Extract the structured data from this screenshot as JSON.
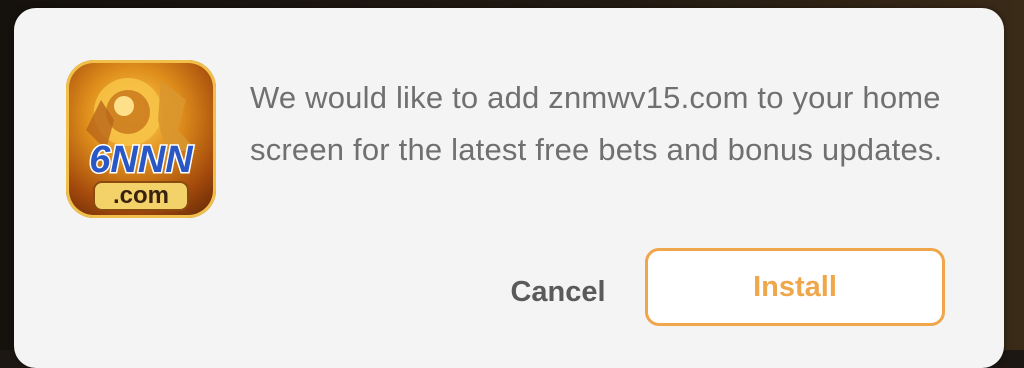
{
  "dialog": {
    "message": "We would like to add znmwv15.com to your home screen for the latest free bets and bonus updates.",
    "app_icon": {
      "icon": "app-logo-icon",
      "brand_text": "6NNN",
      "domain_text": ".com"
    },
    "cancel_label": "Cancel",
    "install_label": "Install"
  },
  "colors": {
    "dialog_background": "#f4f4f4",
    "message_text": "#707070",
    "cancel_text": "#5a5a5a",
    "install_accent": "#f0a64a"
  }
}
